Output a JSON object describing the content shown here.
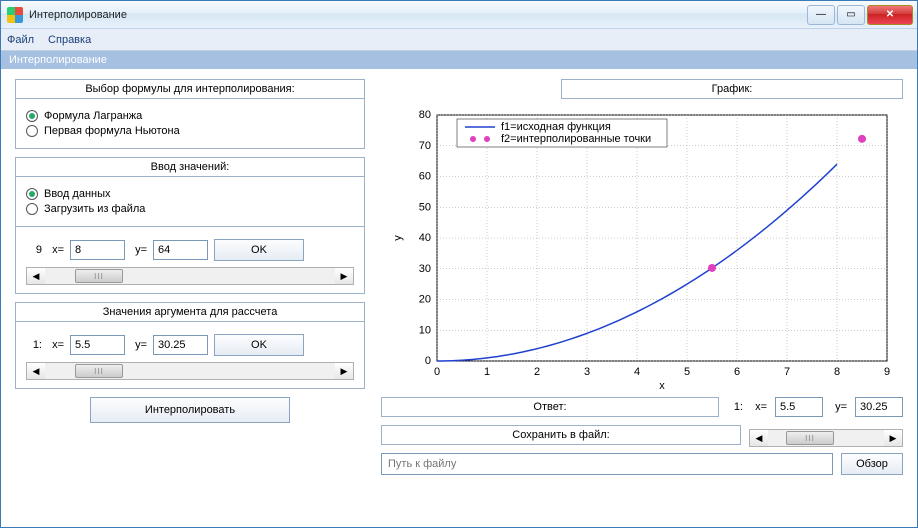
{
  "window": {
    "title": "Интерполирование"
  },
  "menu": {
    "file": "Файл",
    "help": "Справка"
  },
  "subtitle": "Интерполирование",
  "formula": {
    "title": "Выбор формулы для интерполирования:",
    "lagrange": "Формула Лагранжа",
    "newton": "Первая формула Ньютона",
    "selected": "lagrange"
  },
  "input": {
    "title": "Ввод значений:",
    "manual": "Ввод данных",
    "fromfile": "Загрузить из файла",
    "selected": "manual",
    "index": "9",
    "xlabel": "x=",
    "xval": "8",
    "ylabel": "y=",
    "yval": "64",
    "ok": "OK"
  },
  "args": {
    "title": "Значения аргумента для рассчета",
    "index": "1:",
    "xlabel": "x=",
    "xval": "5.5",
    "ylabel": "y=",
    "yval": "30.25",
    "ok": "OK"
  },
  "interpolate_btn": "Интерполировать",
  "chart_title": "График:",
  "chart_data": {
    "type": "line+scatter",
    "title": "",
    "xlabel": "x",
    "ylabel": "y",
    "xlim": [
      0,
      9
    ],
    "ylim": [
      0,
      80
    ],
    "xticks": [
      0,
      1,
      2,
      3,
      4,
      5,
      6,
      7,
      8,
      9
    ],
    "yticks": [
      0,
      10,
      20,
      30,
      40,
      50,
      60,
      70,
      80
    ],
    "series": [
      {
        "name": "f1=исходная функция",
        "type": "line",
        "color": "#2040d0",
        "x": [
          0,
          1,
          2,
          3,
          4,
          5,
          6,
          7,
          8
        ],
        "y": [
          0,
          1,
          4,
          9,
          16,
          25,
          36,
          49,
          64
        ]
      },
      {
        "name": "f2=интерполированные точки",
        "type": "scatter",
        "color": "#e040c0",
        "x": [
          5.5,
          8.5
        ],
        "y": [
          30.25,
          72.25
        ]
      }
    ]
  },
  "answer": {
    "label": "Ответ:",
    "index": "1:",
    "xlabel": "x=",
    "xval": "5.5",
    "ylabel": "y=",
    "yval": "30.25"
  },
  "save": {
    "label": "Сохранить в файл:",
    "path_placeholder": "Путь к файлу",
    "browse": "Обзор"
  },
  "scroll_thumb": "III"
}
